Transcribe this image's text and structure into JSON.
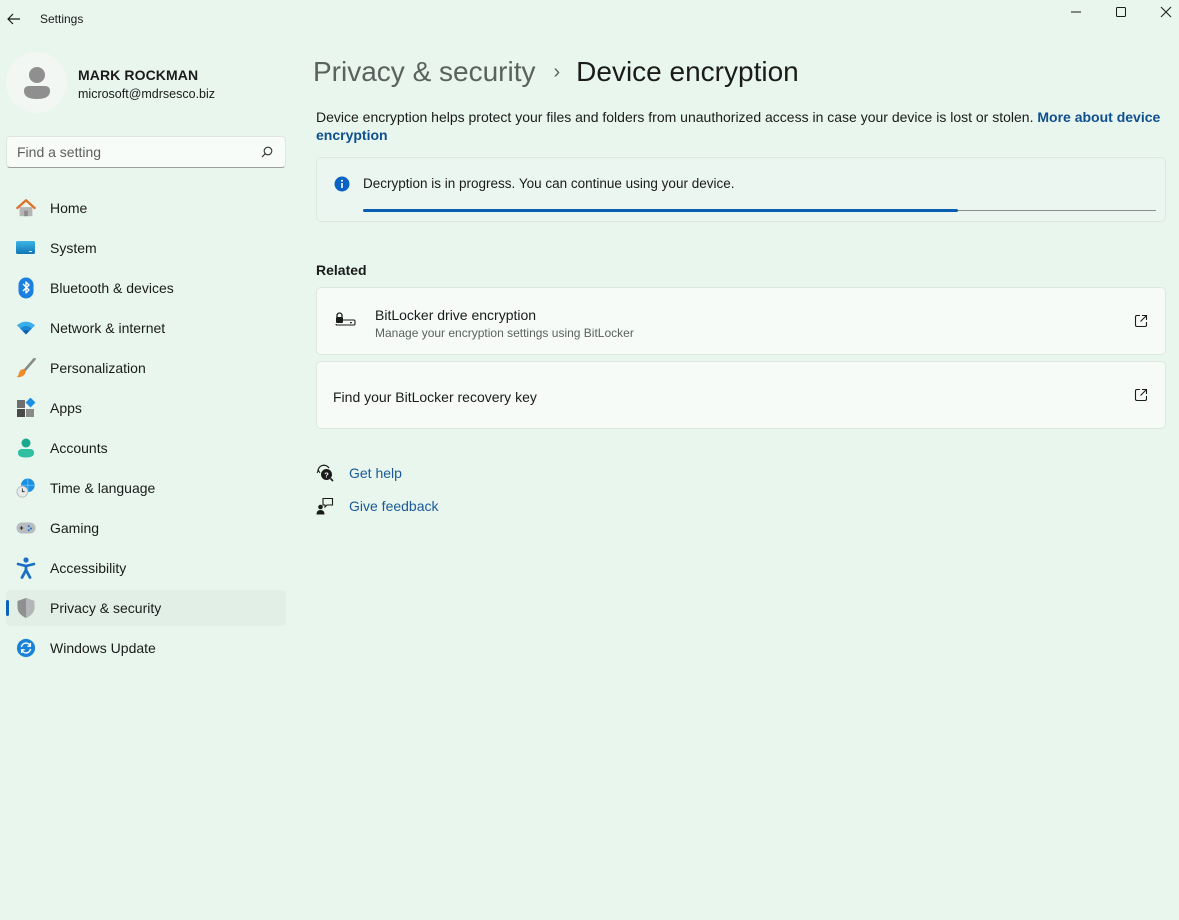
{
  "window": {
    "title": "Settings",
    "controls": {
      "minimize": "minimize-icon",
      "maximize": "maximize-icon",
      "close": "close-icon"
    },
    "back_icon": "back-arrow-icon"
  },
  "profile": {
    "name": "MARK ROCKMAN",
    "email": "microsoft@mdrsesco.biz",
    "avatar_icon": "person-icon"
  },
  "search": {
    "placeholder": "Find a setting",
    "value": "",
    "icon": "search-icon"
  },
  "sidebar": {
    "items": [
      {
        "id": "home",
        "label": "Home",
        "icon": "home-icon",
        "selected": false
      },
      {
        "id": "system",
        "label": "System",
        "icon": "system-display-icon",
        "selected": false
      },
      {
        "id": "bluetooth",
        "label": "Bluetooth & devices",
        "icon": "bluetooth-icon",
        "selected": false
      },
      {
        "id": "network",
        "label": "Network & internet",
        "icon": "wifi-icon",
        "selected": false
      },
      {
        "id": "personalization",
        "label": "Personalization",
        "icon": "paintbrush-icon",
        "selected": false
      },
      {
        "id": "apps",
        "label": "Apps",
        "icon": "apps-icon",
        "selected": false
      },
      {
        "id": "accounts",
        "label": "Accounts",
        "icon": "accounts-icon",
        "selected": false
      },
      {
        "id": "time",
        "label": "Time & language",
        "icon": "globe-clock-icon",
        "selected": false
      },
      {
        "id": "gaming",
        "label": "Gaming",
        "icon": "gamepad-icon",
        "selected": false
      },
      {
        "id": "accessibility",
        "label": "Accessibility",
        "icon": "accessibility-icon",
        "selected": false
      },
      {
        "id": "privacy",
        "label": "Privacy & security",
        "icon": "shield-icon",
        "selected": true
      },
      {
        "id": "update",
        "label": "Windows Update",
        "icon": "update-icon",
        "selected": false
      }
    ]
  },
  "main": {
    "breadcrumb": {
      "parent": "Privacy & security",
      "separator": "›",
      "current": "Device encryption"
    },
    "description": {
      "text": "Device encryption helps protect your files and folders from unauthorized access in case your device is lost or stolen. ",
      "link": "More about device encryption"
    },
    "status": {
      "icon": "info-icon",
      "message": "Decryption is in progress. You can continue using your device.",
      "progress_percent": 75,
      "accent_color": "#0a5fb0"
    },
    "related": {
      "title": "Related",
      "items": [
        {
          "title": "BitLocker drive encryption",
          "subtitle": "Manage your encryption settings using BitLocker",
          "icon": "bitlocker-drive-icon",
          "action_icon": "open-external-icon"
        },
        {
          "title": "Find your BitLocker recovery key",
          "action_icon": "open-external-icon"
        }
      ]
    },
    "help_links": [
      {
        "label": "Get help",
        "icon": "get-help-icon"
      },
      {
        "label": "Give feedback",
        "icon": "feedback-icon"
      }
    ]
  }
}
